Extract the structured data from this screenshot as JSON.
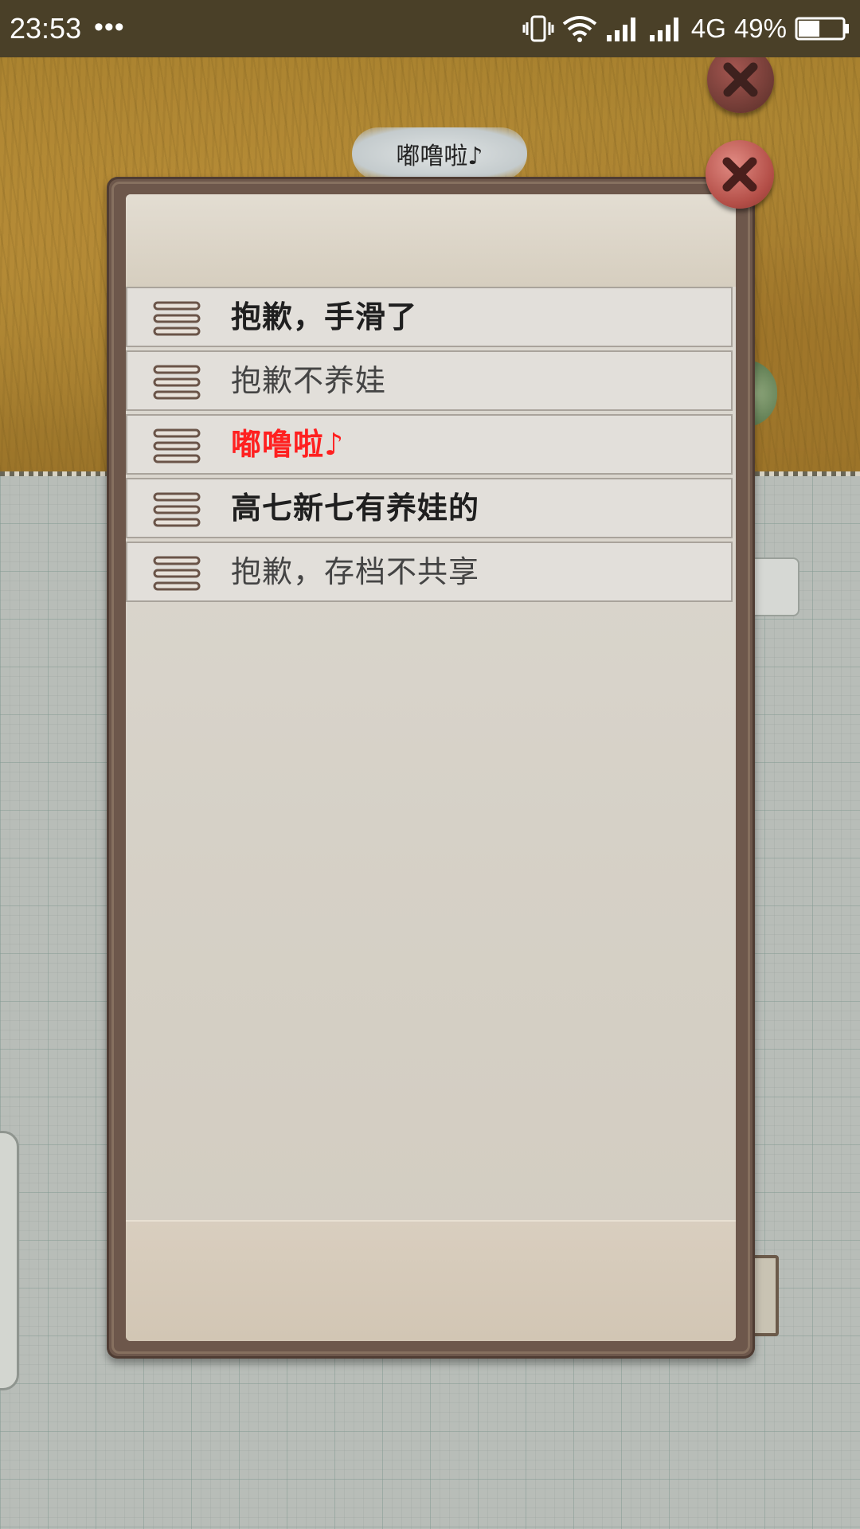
{
  "status_bar": {
    "time": "23:53",
    "dots": "•••",
    "network": "4G",
    "battery": "49%",
    "battery_level": 0.49
  },
  "scene": {
    "name_bubble": "嘟噜啦♪"
  },
  "dialog": {
    "phrases": [
      {
        "text": "抱歉，手滑了",
        "color": "#1f1f1f",
        "bold": true
      },
      {
        "text": "抱歉不养娃",
        "color": "#444444",
        "bold": false
      },
      {
        "text": "嘟噜啦♪",
        "color": "#ff2020",
        "bold": true
      },
      {
        "text": "高七新七有养娃的",
        "color": "#1f1f1f",
        "bold": true
      },
      {
        "text": "抱歉，存档不共享",
        "color": "#444444",
        "bold": false
      }
    ]
  },
  "colors": {
    "frame": "#6d574b",
    "close_button": "#b44f48",
    "highlight_text": "#ff2020"
  }
}
